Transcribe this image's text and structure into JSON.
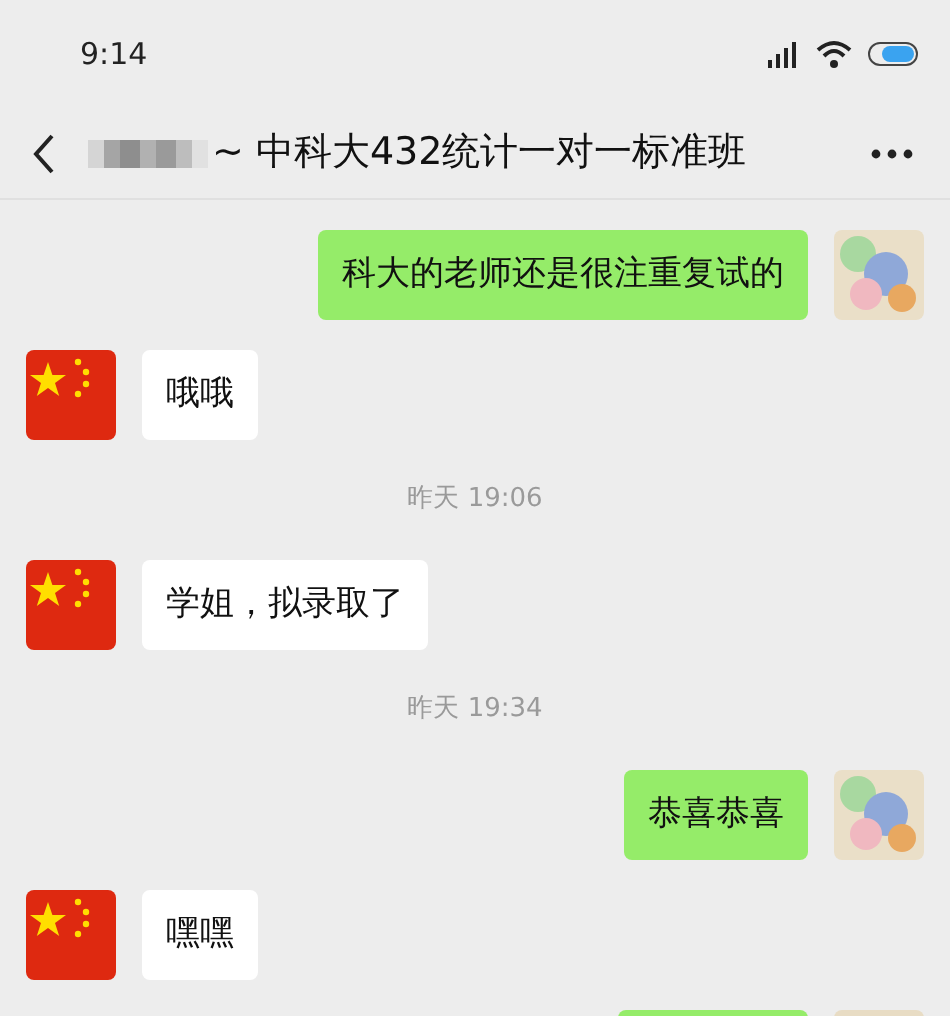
{
  "status_bar": {
    "time": "9:14"
  },
  "header": {
    "title": "~ 中科大432统计一对一标准班"
  },
  "messages": [
    {
      "kind": "sent",
      "text": "科大的老师还是很注重复试的"
    },
    {
      "kind": "received",
      "text": "哦哦"
    },
    {
      "kind": "time",
      "text": "昨天 19:06"
    },
    {
      "kind": "received",
      "text": "学姐，拟录取了"
    },
    {
      "kind": "time",
      "text": "昨天 19:34"
    },
    {
      "kind": "sent",
      "text": "恭喜恭喜"
    },
    {
      "kind": "received",
      "text": "嘿嘿"
    },
    {
      "kind": "sent_cut"
    }
  ]
}
